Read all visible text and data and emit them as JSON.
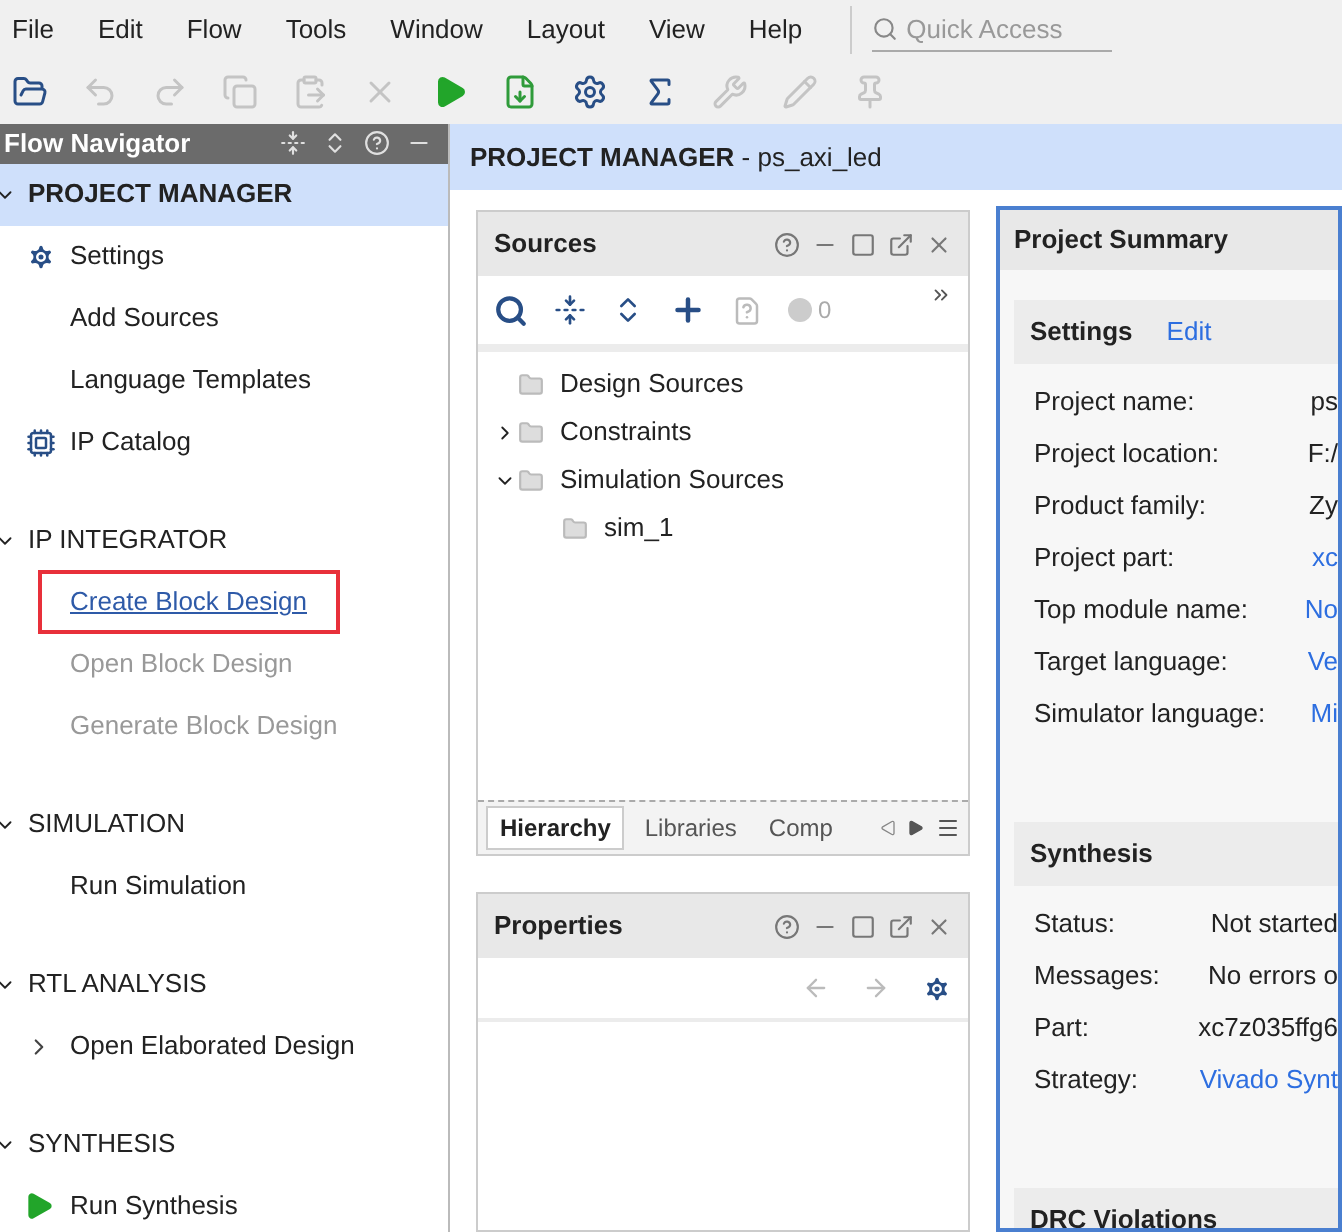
{
  "menu_bar": {
    "items": [
      "File",
      "Edit",
      "Flow",
      "Tools",
      "Window",
      "Layout",
      "View",
      "Help"
    ],
    "search": {
      "placeholder": "Quick Access"
    }
  },
  "toolbar": [
    {
      "kind": "open",
      "disabled": false
    },
    {
      "kind": "undo",
      "disabled": true
    },
    {
      "kind": "redo",
      "disabled": true
    },
    {
      "kind": "copy",
      "disabled": true
    },
    {
      "kind": "paste",
      "disabled": true
    },
    {
      "kind": "delete",
      "disabled": true
    },
    {
      "kind": "run",
      "disabled": false
    },
    {
      "kind": "bitstream",
      "disabled": false
    },
    {
      "kind": "settings",
      "disabled": false
    },
    {
      "kind": "sigma",
      "disabled": false
    },
    {
      "kind": "tool",
      "disabled": true
    },
    {
      "kind": "probe",
      "disabled": true
    },
    {
      "kind": "pin",
      "disabled": true
    }
  ],
  "flow_navigator": {
    "title": "Flow Navigator",
    "sections": [
      {
        "title": "PROJECT MANAGER",
        "selected": true,
        "items": [
          {
            "kind": "gear",
            "label": "Settings",
            "disabled": false,
            "highlighted": false
          },
          {
            "kind": "plain",
            "label": "Add Sources",
            "disabled": false,
            "highlighted": false
          },
          {
            "kind": "plain",
            "label": "Language Templates",
            "disabled": false,
            "highlighted": false
          },
          {
            "kind": "ip",
            "label": "IP Catalog",
            "disabled": false,
            "highlighted": false
          }
        ]
      },
      {
        "title": "IP INTEGRATOR",
        "selected": false,
        "items": [
          {
            "kind": "link",
            "label": "Create Block Design",
            "disabled": false,
            "highlighted": true
          },
          {
            "kind": "plain",
            "label": "Open Block Design",
            "disabled": true,
            "highlighted": false
          },
          {
            "kind": "plain",
            "label": "Generate Block Design",
            "disabled": true,
            "highlighted": false
          }
        ]
      },
      {
        "title": "SIMULATION",
        "selected": false,
        "items": [
          {
            "kind": "plain",
            "label": "Run Simulation",
            "disabled": false,
            "highlighted": false
          }
        ]
      },
      {
        "title": "RTL ANALYSIS",
        "selected": false,
        "items": [
          {
            "kind": "chevron",
            "label": "Open Elaborated Design",
            "disabled": false,
            "highlighted": false
          }
        ]
      },
      {
        "title": "SYNTHESIS",
        "selected": false,
        "items": [
          {
            "kind": "play",
            "label": "Run Synthesis",
            "disabled": false,
            "highlighted": false
          }
        ]
      }
    ]
  },
  "header": {
    "title": "**PROJECT MANAGER** - ps_axi_led"
  },
  "sources": {
    "title": "Sources",
    "badge": "0",
    "tree": [
      {
        "label": "Design Sources",
        "kind": "leaf"
      },
      {
        "label": "Constraints",
        "kind": "branch",
        "expanded": false
      },
      {
        "label": "Simulation Sources",
        "kind": "branch",
        "expanded": true,
        "children": [
          {
            "label": "sim_1",
            "kind": "leaf"
          }
        ]
      }
    ],
    "tabs": [
      {
        "label": "Hierarchy",
        "selected": true
      },
      {
        "label": "Libraries",
        "selected": false
      },
      {
        "label": "Comp",
        "selected": false
      }
    ]
  },
  "properties": {
    "title": "Properties"
  },
  "project_summary": {
    "title": "Project Summary",
    "sections": [
      {
        "title": "Settings",
        "link": "Edit",
        "rows": [
          {
            "label": "Project name:",
            "value": "ps",
            "kind": "text"
          },
          {
            "label": "Project location:",
            "value": "F:/",
            "kind": "text"
          },
          {
            "label": "Product family:",
            "value": "Zy",
            "kind": "text"
          },
          {
            "label": "Project part:",
            "value": "xc",
            "kind": "link"
          },
          {
            "label": "Top module name:",
            "value": "No",
            "kind": "link"
          },
          {
            "label": "Target language:",
            "value": "Ve",
            "kind": "link"
          },
          {
            "label": "Simulator language:",
            "value": "Mi",
            "kind": "link"
          }
        ]
      },
      {
        "title": "Synthesis",
        "rows": [
          {
            "label": "Status:",
            "value": "Not started",
            "kind": "text"
          },
          {
            "label": "Messages:",
            "value": "No errors o",
            "kind": "text"
          },
          {
            "label": "Part:",
            "value": "xc7z035ffg6",
            "kind": "text"
          },
          {
            "label": "Strategy:",
            "value": "Vivado Synt",
            "kind": "link"
          }
        ]
      },
      {
        "title": "DRC Violations"
      }
    ]
  }
}
